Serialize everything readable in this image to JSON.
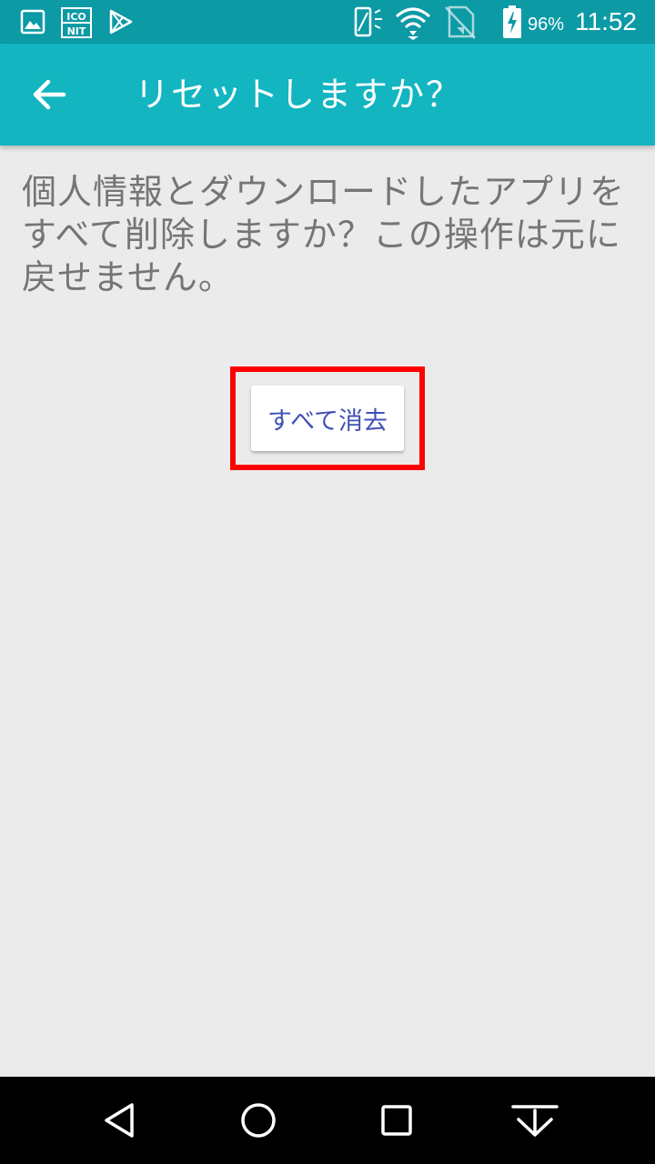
{
  "status_bar": {
    "battery_percent": "96%",
    "time": "11:52",
    "notification_icons": [
      "gallery-icon",
      "iconit-icon",
      "play-store-icon"
    ],
    "system_icons": [
      "vibrate-icon",
      "wifi-icon",
      "no-sim-icon",
      "battery-charging-icon"
    ],
    "iconit_text_top": "ICO",
    "iconit_text_bottom": "NIT",
    "background_color": "#0c9aa5"
  },
  "app_bar": {
    "title": "リセットしますか？",
    "back_icon": "arrow-back-icon",
    "background_color": "#12b5c0"
  },
  "content": {
    "message": "個人情報とダウンロードしたアプリをすべて削除しますか？この操作は元に戻せません。",
    "erase_button_label": "すべて消去",
    "accent_color": "#3f51b5",
    "highlight_color": "#ff0000"
  },
  "nav_bar": {
    "buttons": [
      "back-triangle-icon",
      "home-circle-icon",
      "recents-square-icon",
      "notification-pull-icon"
    ]
  }
}
